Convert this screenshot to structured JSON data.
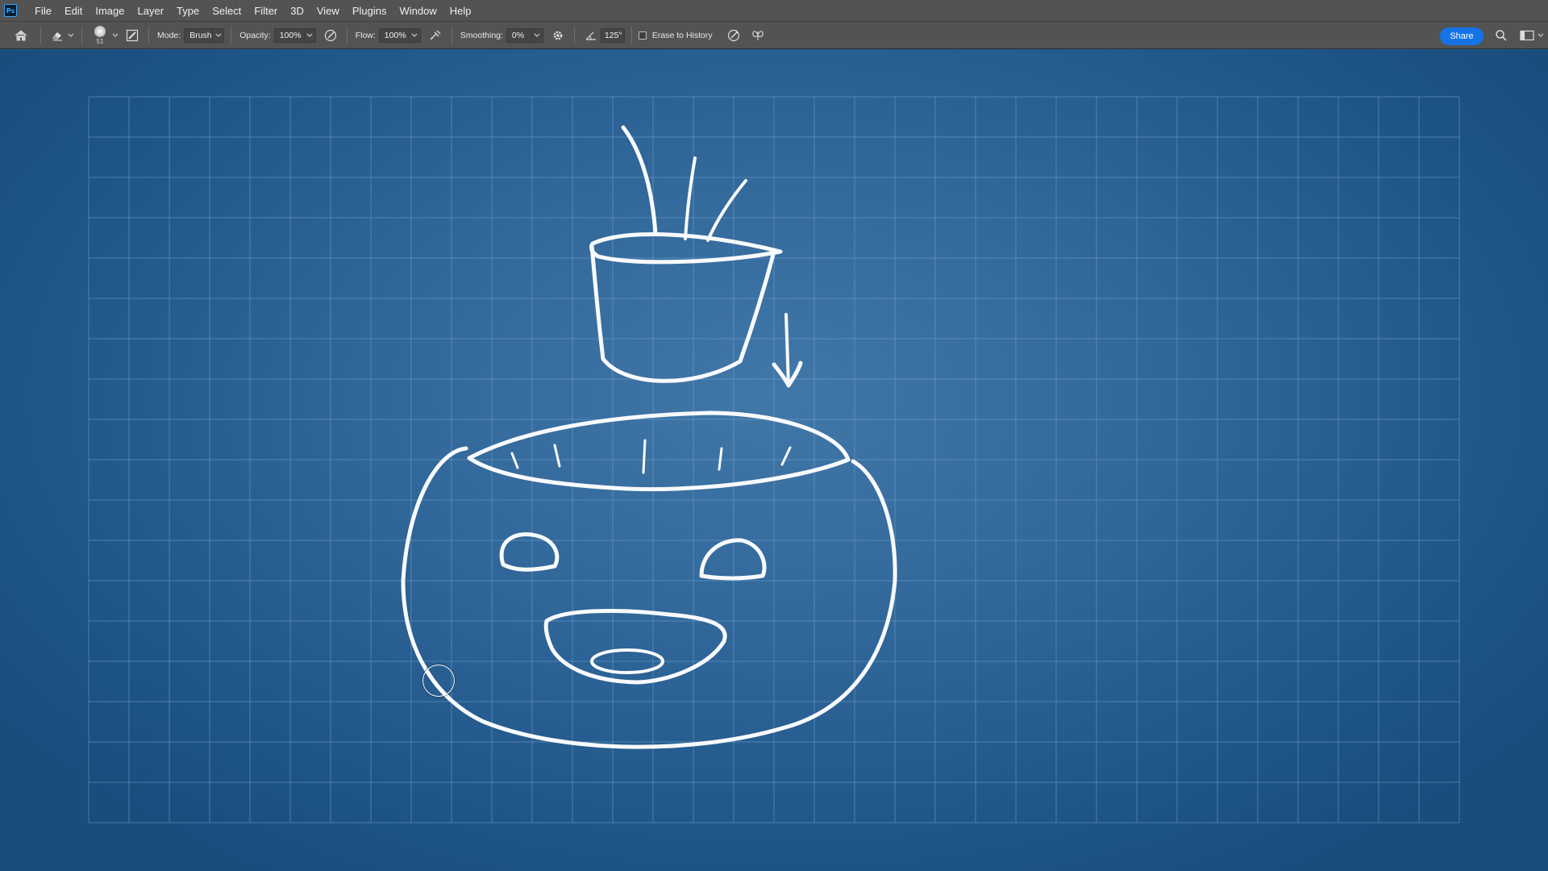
{
  "app": {
    "logo_text": "Ps",
    "menu": [
      "File",
      "Edit",
      "Image",
      "Layer",
      "Type",
      "Select",
      "Filter",
      "3D",
      "View",
      "Plugins",
      "Window",
      "Help"
    ]
  },
  "options_bar": {
    "home_icon": "home-icon",
    "tool_icon": "eraser-icon",
    "brush_size": "51",
    "mode_label": "Mode:",
    "mode_value": "Brush",
    "opacity_label": "Opacity:",
    "opacity_value": "100%",
    "flow_label": "Flow:",
    "flow_value": "100%",
    "smoothing_label": "Smoothing:",
    "smoothing_value": "0%",
    "angle_value": "125°",
    "erase_to_history_label": "Erase to History",
    "erase_to_history_checked": false,
    "share_label": "Share"
  },
  "canvas": {
    "background_color": "#2f6598",
    "grid_color": "#6fa3cf",
    "chalk_color": "#f7f9fb"
  }
}
